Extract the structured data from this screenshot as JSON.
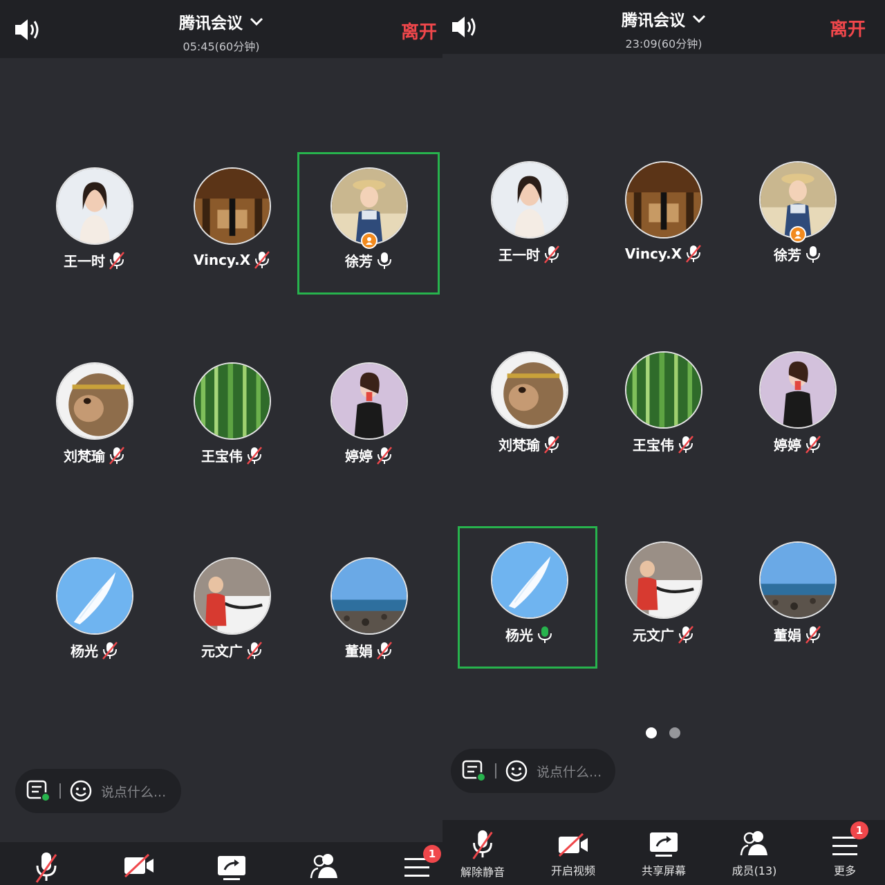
{
  "left": {
    "header": {
      "title": "腾讯会议",
      "subtitle": "05:45(60分钟)",
      "leave_label": "离开"
    },
    "participants": [
      {
        "name": "王一时",
        "mic": "muted"
      },
      {
        "name": "Vincy.X",
        "mic": "muted"
      },
      {
        "name": "徐芳",
        "mic": "on",
        "host": true,
        "speaking_frame": true
      },
      {
        "name": "刘梵瑜",
        "mic": "muted"
      },
      {
        "name": "王宝伟",
        "mic": "muted"
      },
      {
        "name": "婷婷",
        "mic": "muted"
      },
      {
        "name": "杨光",
        "mic": "muted"
      },
      {
        "name": "元文广",
        "mic": "muted"
      },
      {
        "name": "董娟",
        "mic": "muted"
      }
    ],
    "chat": {
      "placeholder": "说点什么..."
    },
    "more_badge": "1"
  },
  "right": {
    "header": {
      "title": "腾讯会议",
      "subtitle": "23:09(60分钟)",
      "leave_label": "离开"
    },
    "participants": [
      {
        "name": "王一时",
        "mic": "muted"
      },
      {
        "name": "Vincy.X",
        "mic": "muted"
      },
      {
        "name": "徐芳",
        "mic": "on",
        "host": true
      },
      {
        "name": "刘梵瑜",
        "mic": "muted"
      },
      {
        "name": "王宝伟",
        "mic": "muted"
      },
      {
        "name": "婷婷",
        "mic": "muted"
      },
      {
        "name": "杨光",
        "mic": "speaking",
        "speaking_frame": true
      },
      {
        "name": "元文广",
        "mic": "muted"
      },
      {
        "name": "董娟",
        "mic": "muted"
      }
    ],
    "chat": {
      "placeholder": "说点什么..."
    },
    "toolbar": {
      "unmute_label": "解除静音",
      "video_label": "开启视频",
      "share_label": "共享屏幕",
      "members_label": "成员(13)",
      "more_label": "更多"
    },
    "more_badge": "1"
  },
  "colors": {
    "accent_green": "#27b34d",
    "leave_red": "#f0474b",
    "bg": "#2b2c31",
    "bar": "#202125"
  }
}
